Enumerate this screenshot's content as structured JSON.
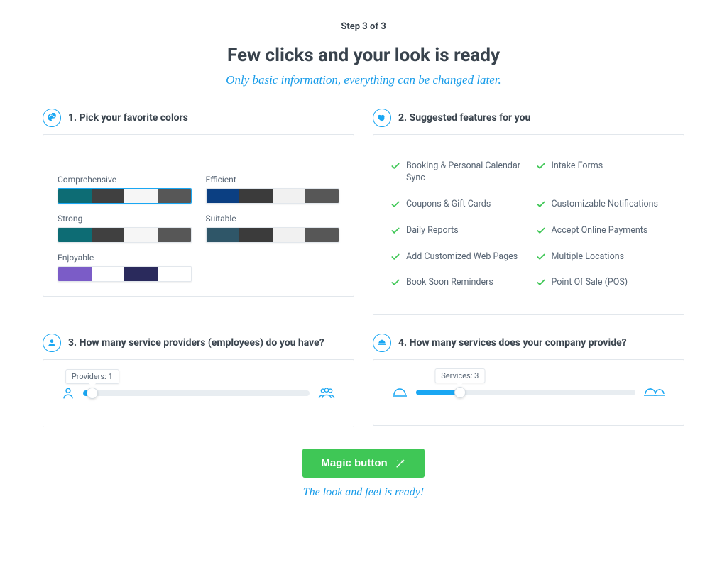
{
  "header": {
    "step": "Step 3 of 3",
    "title": "Few clicks and your look is ready",
    "subtitle": "Only basic information, everything can be changed later."
  },
  "sections": {
    "colors": {
      "title": "1. Pick your favorite colors",
      "palettes": [
        {
          "label": "Comprehensive",
          "selected": true,
          "colors": [
            "#0d6c74",
            "#404040",
            "#f6f6f6",
            "#575757"
          ]
        },
        {
          "label": "Efficient",
          "selected": false,
          "colors": [
            "#0b3f82",
            "#3b3b3b",
            "#f1f1f1",
            "#575757"
          ]
        },
        {
          "label": "Strong",
          "selected": false,
          "colors": [
            "#0d6c74",
            "#404040",
            "#f6f6f6",
            "#575757"
          ]
        },
        {
          "label": "Suitable",
          "selected": false,
          "colors": [
            "#2f5668",
            "#3b3b3b",
            "#f1f1f1",
            "#575757"
          ]
        },
        {
          "label": "Enjoyable",
          "selected": false,
          "colors": [
            "#7b5cc7",
            "#ffffff",
            "#2a2a5c",
            "#ffffff"
          ]
        }
      ]
    },
    "features": {
      "title": "2. Suggested features for you",
      "left": [
        "Booking & Personal Calendar Sync",
        "Coupons & Gift Cards",
        "Daily Reports",
        "Add Customized Web Pages",
        "Book Soon Reminders"
      ],
      "right": [
        "Intake Forms",
        "Customizable Notifications",
        "Accept Online Payments",
        "Multiple Locations",
        "Point Of Sale (POS)"
      ]
    },
    "providers": {
      "title": "3. How many service providers (employees) do you have?",
      "tooltip": "Providers: 1",
      "percent": 4
    },
    "services": {
      "title": "4. How many services does your company provide?",
      "tooltip": "Services: 3",
      "percent": 20
    }
  },
  "footer": {
    "button": "Magic button",
    "subtitle": "The look and feel is ready!"
  }
}
